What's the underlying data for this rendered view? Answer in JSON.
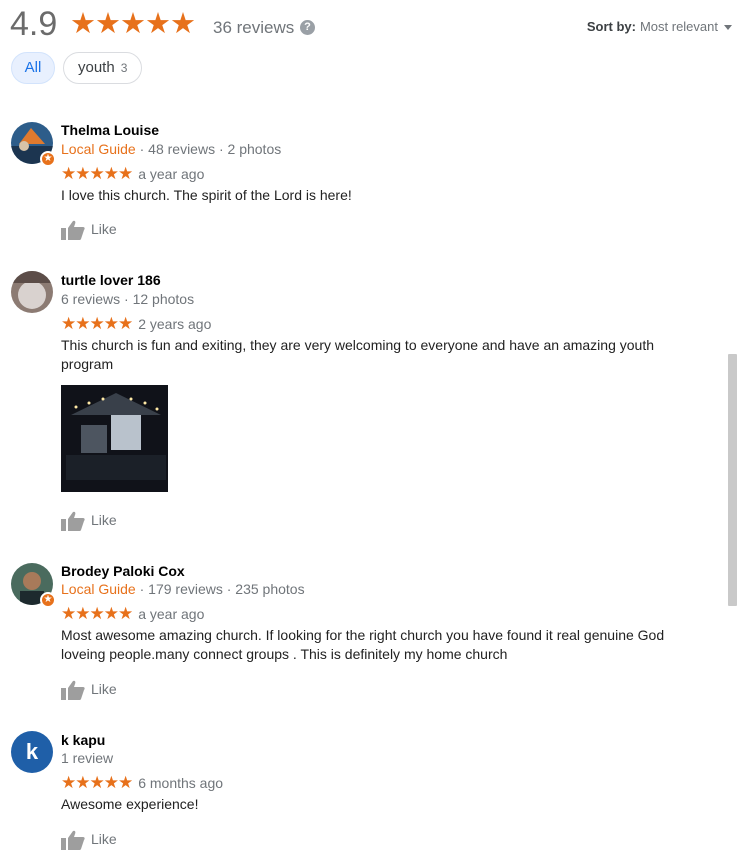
{
  "summary": {
    "rating": "4.9",
    "stars": "★★★★★",
    "review_count": "36 reviews",
    "help_icon": "?",
    "sort_label": "Sort by:",
    "sort_value": "Most relevant"
  },
  "filters": [
    {
      "label": "All",
      "count": ""
    },
    {
      "label": "youth",
      "count": "3"
    }
  ],
  "colors": {
    "accent_star": "#e7711b",
    "chip_active": "#1a73e8"
  },
  "reviews": [
    {
      "name": "Thelma Louise",
      "guide": "Local Guide",
      "meta": " · 48 reviews · 2 photos",
      "stars": "★★★★★",
      "time": "a year ago",
      "text": "I love this church. The spirit of the Lord is here!",
      "like": "Like"
    },
    {
      "name": "turtle lover 186",
      "guide": "",
      "meta": "6 reviews · 12 photos",
      "stars": "★★★★★",
      "time": "2 years ago",
      "text": "This church is fun and exiting, they are very welcoming to everyone and have an amazing youth program",
      "like": "Like"
    },
    {
      "name": "Brodey Paloki Cox",
      "guide": "Local Guide",
      "meta": " · 179 reviews · 235 photos",
      "stars": "★★★★★",
      "time": "a year ago",
      "text": "Most awesome amazing church. If looking for the right church you have found it real genuine God loveing people.many connect groups . This is definitely my home church",
      "like": "Like"
    },
    {
      "name": "k kapu",
      "guide": "",
      "meta": "1 review",
      "stars": "★★★★★",
      "time": "6 months ago",
      "text": "Awesome experience!",
      "like": "Like",
      "initial": "k"
    }
  ]
}
